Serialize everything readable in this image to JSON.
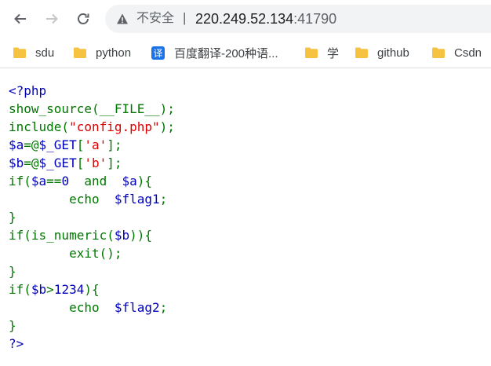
{
  "browser": {
    "security_label": "不安全",
    "separator": "|",
    "url_host": "220.249.52.134",
    "url_port": ":41790"
  },
  "bookmarks": [
    {
      "label": "sdu",
      "icon": "folder-icon"
    },
    {
      "label": "python",
      "icon": "folder-icon"
    },
    {
      "label": "百度翻译-200种语...",
      "icon": "translate-icon",
      "icon_char": "译"
    },
    {
      "label": "学",
      "icon": "folder-icon"
    },
    {
      "label": "github",
      "icon": "folder-icon"
    },
    {
      "label": "Csdn",
      "icon": "folder-icon"
    }
  ],
  "colors": {
    "html": "#0000bb",
    "keyword": "#007700",
    "string": "#dd0000",
    "folder": "#f5c242"
  },
  "code_lines": [
    [
      {
        "t": "<?php",
        "c": "html"
      }
    ],
    [
      {
        "t": "show_source(__FILE__);",
        "c": "kw"
      }
    ],
    [
      {
        "t": "include(",
        "c": "kw"
      },
      {
        "t": "\"config.php\"",
        "c": "str"
      },
      {
        "t": ");",
        "c": "kw"
      }
    ],
    [
      {
        "t": "$a",
        "c": "var"
      },
      {
        "t": "=@",
        "c": "kw"
      },
      {
        "t": "$_GET",
        "c": "var"
      },
      {
        "t": "[",
        "c": "kw"
      },
      {
        "t": "'a'",
        "c": "str"
      },
      {
        "t": "];",
        "c": "kw"
      }
    ],
    [
      {
        "t": "$b",
        "c": "var"
      },
      {
        "t": "=@",
        "c": "kw"
      },
      {
        "t": "$_GET",
        "c": "var"
      },
      {
        "t": "[",
        "c": "kw"
      },
      {
        "t": "'b'",
        "c": "str"
      },
      {
        "t": "];",
        "c": "kw"
      }
    ],
    [
      {
        "t": "if(",
        "c": "kw"
      },
      {
        "t": "$a",
        "c": "var"
      },
      {
        "t": "==",
        "c": "kw"
      },
      {
        "t": "0 ",
        "c": "var"
      },
      {
        "t": " and ",
        "c": "kw"
      },
      {
        "t": " $a",
        "c": "var"
      },
      {
        "t": "){",
        "c": "kw"
      }
    ],
    [
      {
        "t": "        echo ",
        "c": "kw"
      },
      {
        "t": " $flag1",
        "c": "var"
      },
      {
        "t": ";",
        "c": "kw"
      }
    ],
    [
      {
        "t": "}",
        "c": "kw"
      }
    ],
    [
      {
        "t": "if(is_numeric(",
        "c": "kw"
      },
      {
        "t": "$b",
        "c": "var"
      },
      {
        "t": ")){",
        "c": "kw"
      }
    ],
    [
      {
        "t": "        exit();",
        "c": "kw"
      }
    ],
    [
      {
        "t": "}",
        "c": "kw"
      }
    ],
    [
      {
        "t": "if(",
        "c": "kw"
      },
      {
        "t": "$b",
        "c": "var"
      },
      {
        "t": ">",
        "c": "kw"
      },
      {
        "t": "1234",
        "c": "var"
      },
      {
        "t": "){",
        "c": "kw"
      }
    ],
    [
      {
        "t": "        echo ",
        "c": "kw"
      },
      {
        "t": " $flag2",
        "c": "var"
      },
      {
        "t": ";",
        "c": "kw"
      }
    ],
    [
      {
        "t": "}",
        "c": "kw"
      }
    ],
    [
      {
        "t": "?>",
        "c": "html"
      }
    ]
  ]
}
